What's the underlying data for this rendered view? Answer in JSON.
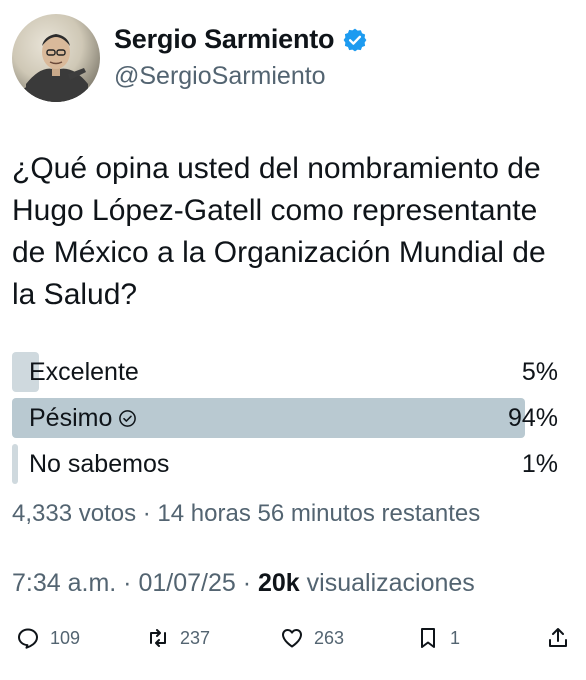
{
  "user": {
    "display_name": "Sergio Sarmiento",
    "handle": "@SergioSarmiento"
  },
  "tweet": {
    "text": "¿Qué opina usted del nombramiento de Hugo López-Gatell como representante de México a la Organización Mundial de la Salud?"
  },
  "poll": {
    "options": [
      {
        "label": "Excelente",
        "percent_text": "5%",
        "fraction": 0.05
      },
      {
        "label": "Pésimo",
        "percent_text": "94%",
        "fraction": 0.94,
        "selected": true
      },
      {
        "label": "No sabemos",
        "percent_text": "1%",
        "fraction": 0.01
      }
    ],
    "meta": "4,333 votos · 14 horas 56 minutos restantes"
  },
  "timestamp": {
    "time_date": "7:34 a.m. · 01/07/25 · ",
    "views_count": "20k",
    "views_label": " visualizaciones"
  },
  "actions": {
    "replies": "109",
    "retweets": "237",
    "likes": "263",
    "bookmarks": "1"
  },
  "colors": {
    "verified": "#1d9bf0",
    "poll_bar": "#cfd9de",
    "poll_bar_winner": "#b9c9d1",
    "secondary_text": "#536471"
  }
}
